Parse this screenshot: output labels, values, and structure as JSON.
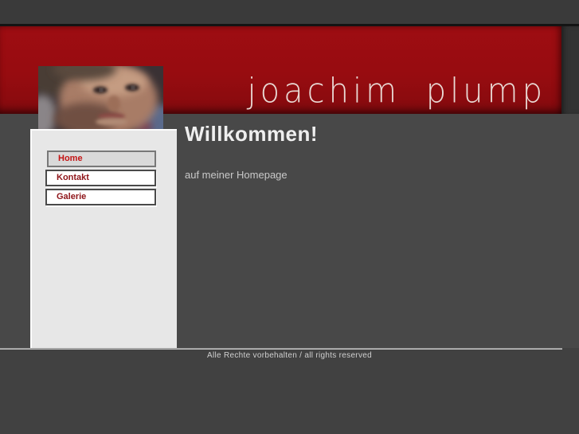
{
  "header": {
    "logo_text": "joachim plump"
  },
  "nav": {
    "items": [
      {
        "label": "Home",
        "active": true
      },
      {
        "label": "Kontakt",
        "active": false
      },
      {
        "label": "Galerie",
        "active": false
      }
    ]
  },
  "content": {
    "title": "Willkommen!",
    "subtitle": "auf meiner Homepage"
  },
  "footer": {
    "copyright": "Alle Rechte vorbehalten / all rights reserved"
  },
  "colors": {
    "banner-red": "#9e0d12",
    "active-red": "#c41414",
    "link-red": "#8e1419"
  }
}
